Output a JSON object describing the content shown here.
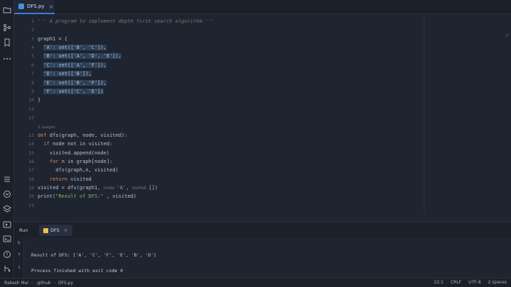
{
  "tab": {
    "filename": "DFS.py",
    "close": "×"
  },
  "editor": {
    "line_numbers": [
      "1",
      "2",
      "3",
      "4",
      "5",
      "6",
      "7",
      "8",
      "9",
      "10",
      "11",
      "12",
      "13",
      "14",
      "15",
      "16",
      "17",
      "18",
      "19",
      "20",
      "21"
    ],
    "lines": {
      "l1": "''' A program to implement depth first search algorithm.'''",
      "l3": "graph1 = {",
      "l4": "'A': set(['B', 'C']),",
      "l5": "'B': set(['A', 'D', 'E']),",
      "l6": "'C': set(['A', 'F']),",
      "l7": "'D': set(['B']),",
      "l8": "'E': set(['B', 'F']),",
      "l9": "'F': set(['C', 'E'])",
      "l10": "}",
      "usages": "2 usages",
      "l13_def": "def",
      "l13_rest": " dfs(graph, node, visited):",
      "l14_if": "if",
      "l14_rest": " node not in visited:",
      "l15": "visited.append(node)",
      "l16_for": "for",
      "l16_rest": " n in graph[node]:",
      "l17": "dfs(graph,n, visited)",
      "l18_ret": "return",
      "l18_rest": " visited",
      "l19_a": "visited = dfs(graph1, ",
      "l19_hint1": "node: ",
      "l19_b": "'A'",
      "l19_c": ", ",
      "l19_hint2": "visited: ",
      "l19_d": "[])",
      "l20_a": "print(",
      "l20_str": "\"Result of DFS:\"",
      "l20_b": " , visited)"
    }
  },
  "run": {
    "label": "Run",
    "tab_name": "DFS",
    "close": "×",
    "output_line1": "Result of DFS: ['A', 'C', 'F', 'E', 'B', 'D']",
    "output_line2": "Process finished with exit code 0"
  },
  "status": {
    "project": "Rakesh Mal",
    "folder": ".github",
    "file": "DFS.py",
    "position": "22:1",
    "line_ending": "CRLF",
    "encoding": "UTF-8",
    "indent": "2 spaces"
  },
  "icons": [
    "folder-icon",
    "git-branch-icon",
    "bookmark-icon",
    "more-icon",
    "list-icon",
    "python-console-icon",
    "layers-icon",
    "terminal-icon",
    "problems-icon",
    "git-icon",
    "rerun-icon",
    "stop-icon",
    "up-arrow-icon",
    "down-arrow-icon"
  ],
  "colors": {
    "accent": "#3d7be0",
    "keyword": "#e0884a",
    "string": "#89b26b",
    "comment": "#6e7f64",
    "background": "#1e2430"
  }
}
